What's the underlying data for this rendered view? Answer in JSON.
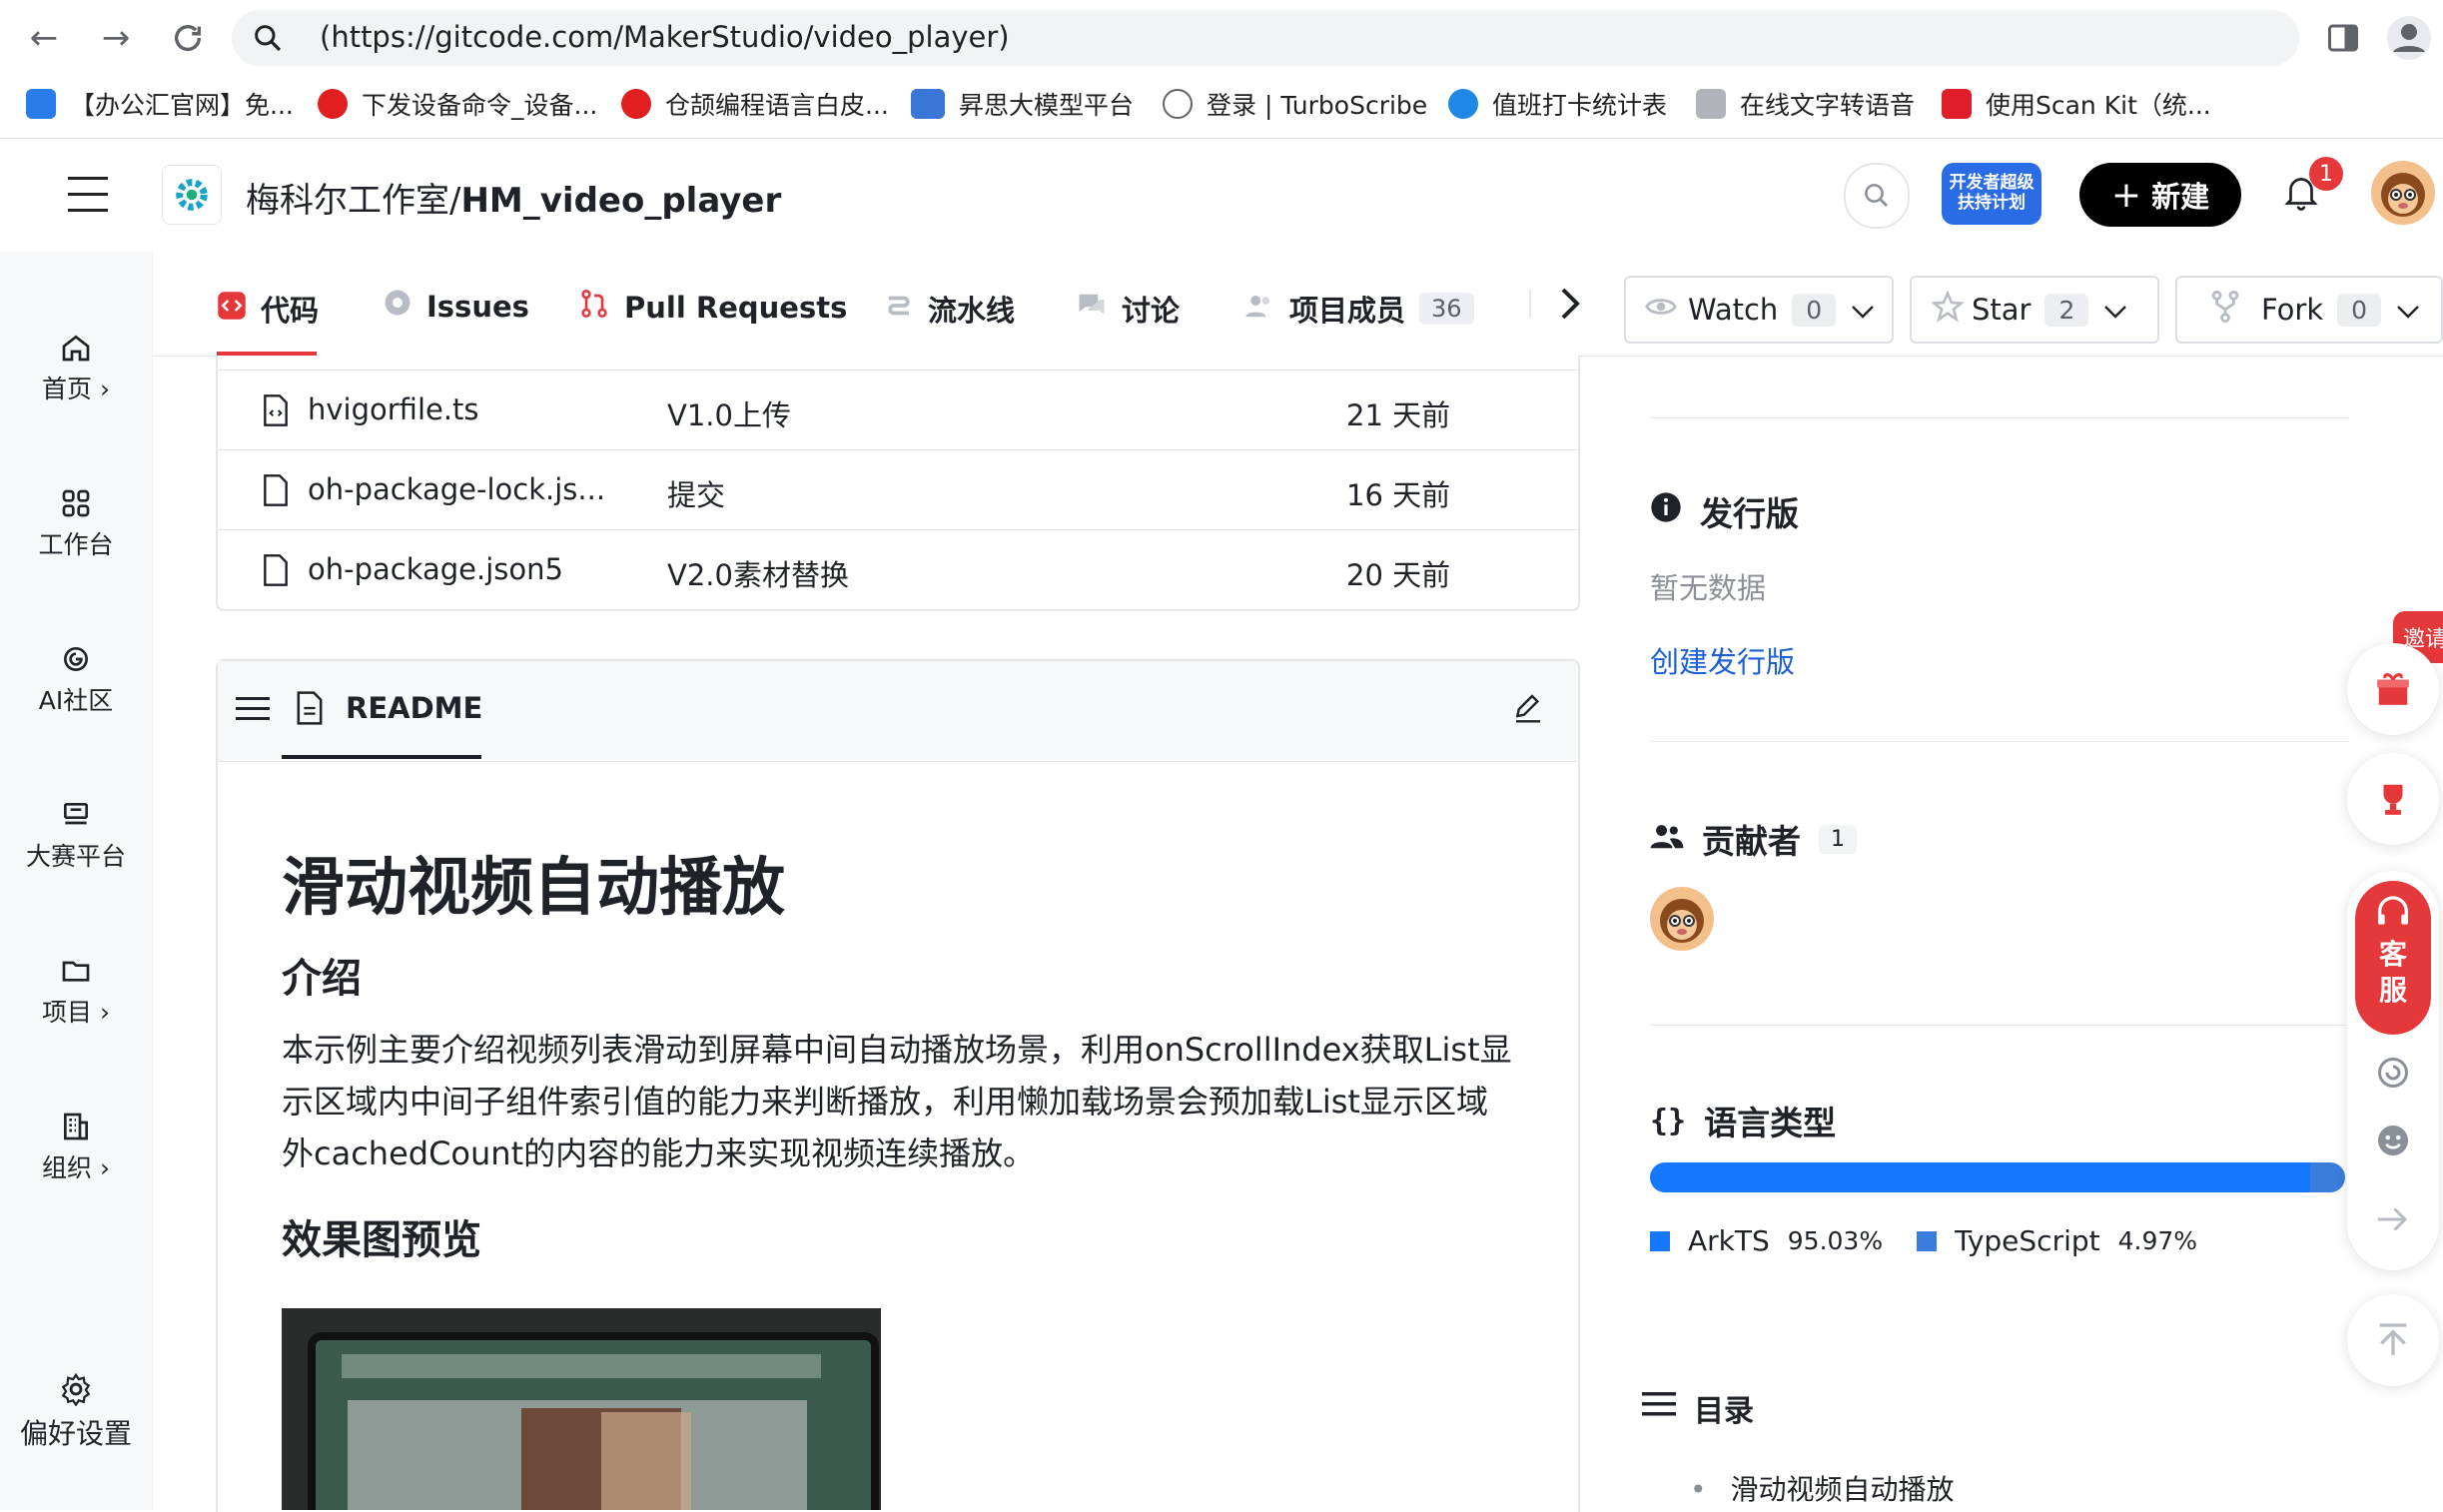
{
  "browser": {
    "url": "(https://gitcode.com/MakerStudio/video_player)",
    "bookmarks": [
      {
        "label": "【办公汇官网】免..."
      },
      {
        "label": "下发设备命令_设备..."
      },
      {
        "label": "仓颉编程语言白皮..."
      },
      {
        "label": "昇思大模型平台"
      },
      {
        "label": "登录 | TurboScribe"
      },
      {
        "label": "值班打卡统计表"
      },
      {
        "label": "在线文字转语音"
      },
      {
        "label": "使用Scan Kit（统..."
      }
    ]
  },
  "header": {
    "repo_owner": "梅科尔工作室/",
    "repo_name": "HM_video_player",
    "new_label": "新建",
    "notification_count": "1",
    "promo_label": "开发者超级扶持计划"
  },
  "sidebar": {
    "items": [
      {
        "label": "首页 ›"
      },
      {
        "label": "工作台"
      },
      {
        "label": "AI社区"
      },
      {
        "label": "大赛平台"
      },
      {
        "label": "项目 ›"
      },
      {
        "label": "组织 ›"
      },
      {
        "label": "偏好设置"
      }
    ]
  },
  "tabs": {
    "items": [
      {
        "label": "代码"
      },
      {
        "label": "Issues"
      },
      {
        "label": "Pull Requests"
      },
      {
        "label": "流水线"
      },
      {
        "label": "讨论"
      },
      {
        "label": "项目成员",
        "count": "36"
      }
    ],
    "watch": {
      "label": "Watch",
      "count": "0"
    },
    "star": {
      "label": "Star",
      "count": "2"
    },
    "fork": {
      "label": "Fork",
      "count": "0"
    }
  },
  "files": [
    {
      "name": "hvigorfile.ts",
      "message": "V1.0上传",
      "time": "21 天前"
    },
    {
      "name": "oh-package-lock.js...",
      "message": "提交",
      "time": "16 天前"
    },
    {
      "name": "oh-package.json5",
      "message": "V2.0素材替换",
      "time": "20 天前"
    }
  ],
  "readme": {
    "tab_label": "README",
    "title": "滑动视频自动播放",
    "intro_heading": "介绍",
    "intro_lines": [
      "本示例主要介绍视频列表滑动到屏幕中间自动播放场景，利用onScrollIndex获取List显",
      "示区域内中间子组件索引值的能力来判断播放，利用懒加载场景会预加载List显示区域",
      "外cachedCount的内容的能力来实现视频连续播放。"
    ],
    "preview_heading": "效果图预览"
  },
  "right": {
    "release_title": "发行版",
    "release_empty": "暂无数据",
    "release_create": "创建发行版",
    "contrib_title": "贡献者",
    "contrib_count": "1",
    "lang_title": "语言类型",
    "languages": [
      {
        "name": "ArkTS",
        "pct": "95.03%",
        "value": 95.03,
        "color": "#1677ff"
      },
      {
        "name": "TypeScript",
        "pct": "4.97%",
        "value": 4.97,
        "color": "#3b7ddd"
      }
    ],
    "toc_title": "目录",
    "toc_items": [
      "滑动视频自动播放"
    ]
  },
  "floating": {
    "invite_label": "邀请",
    "service_label": "客服"
  },
  "colors": {
    "brand_red": "#e5383b",
    "link_blue": "#1a5fd6",
    "primary_black": "#000000"
  }
}
